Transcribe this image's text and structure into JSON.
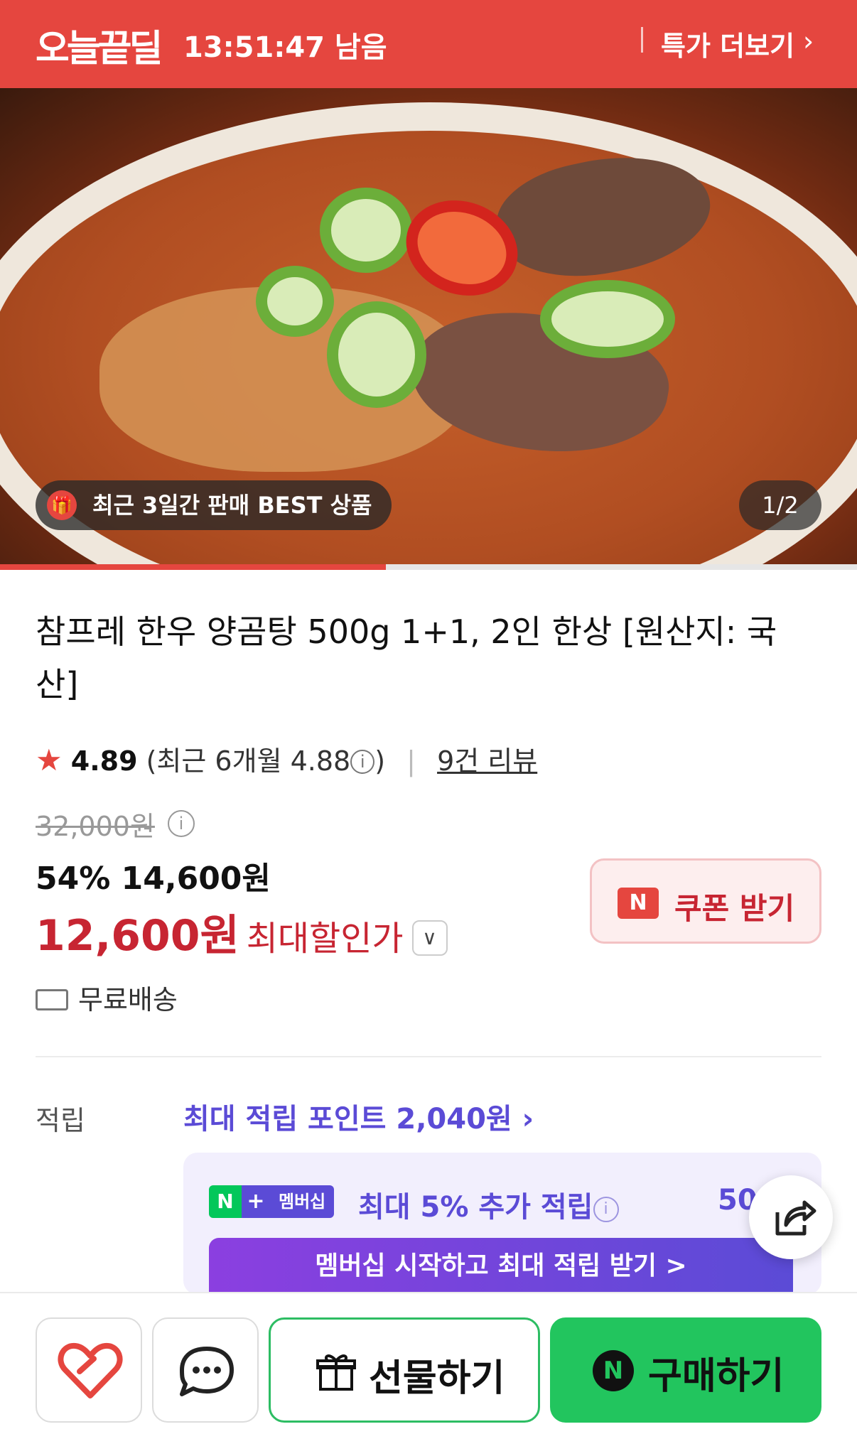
{
  "deal_bar": {
    "logo": "오늘끝딜",
    "timer": "13:51:47 남음",
    "more": "특가 더보기"
  },
  "hero": {
    "best_badge": "최근 3일간 판매 BEST 상품",
    "counter": "1/2",
    "progress_fraction": 0.5,
    "icons": {
      "gift": "gift-icon"
    }
  },
  "product": {
    "title": "참프레 한우 양곰탕 500g 1+1, 2인 한상 [원산지: 국산]",
    "rating": "4.89",
    "rating_recent": "(최근 6개월 4.88",
    "rating_close": ")",
    "reviews": "9건 리뷰",
    "original_price": "32,000원",
    "discount_line": "54% 14,600원",
    "final_price": "12,600원",
    "final_label": "최대할인가",
    "coupon_label": "쿠폰 받기",
    "delivery": "무료배송"
  },
  "points": {
    "label": "적립",
    "link": "최대 적립 포인트 2,040원",
    "membership": {
      "badge_n": "N",
      "badge_plus": "+",
      "badge_text": "멤버십",
      "text": "최대 5% 추가 적립",
      "pct": "50",
      "button": "멤버십 시작하고 최대 적립 받기 >"
    }
  },
  "bottom": {
    "gift_label": "선물하기",
    "buy_label": "구매하기"
  },
  "colors": {
    "brand_red": "#e5463f",
    "price_red": "#c72532",
    "member_purple": "#5b4bd6",
    "buy_green": "#22c55e"
  }
}
